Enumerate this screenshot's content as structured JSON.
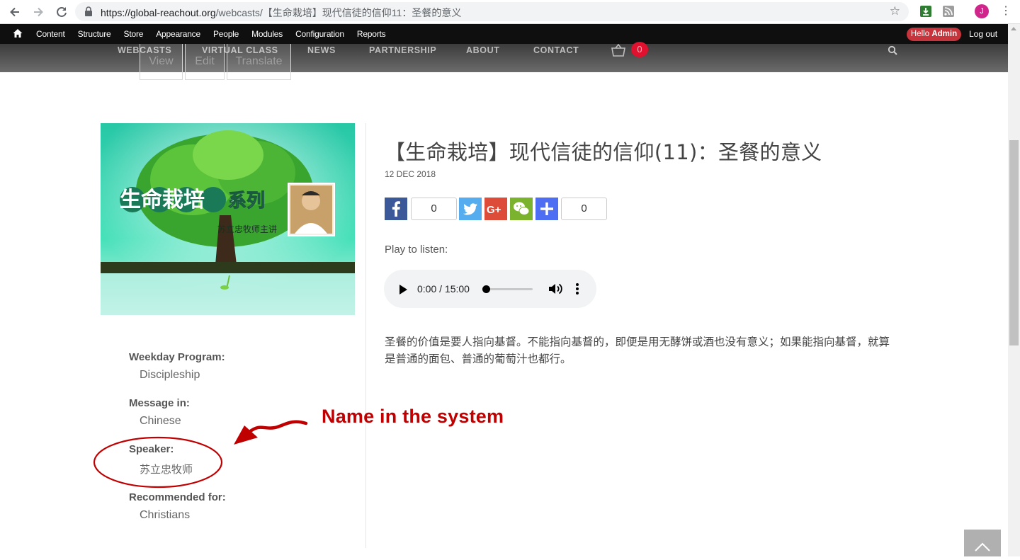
{
  "browser": {
    "url_host": "https://global-reachout.org",
    "url_path": "/webcasts/【生命栽培】现代信徒的信仰11：圣餐的意义",
    "profile_initial": "J",
    "icons": [
      "back-arrow-icon",
      "forward-arrow-icon",
      "reload-icon",
      "lock-icon",
      "star-icon",
      "download-extension-icon",
      "rss-extension-icon",
      "profile-avatar",
      "more-vert-icon"
    ]
  },
  "admin_toolbar": {
    "menu": [
      "Content",
      "Structure",
      "Store",
      "Appearance",
      "People",
      "Modules",
      "Configuration",
      "Reports"
    ],
    "hello_prefix": "Hello",
    "hello_user": "Admin",
    "logout": "Log out"
  },
  "site_nav": {
    "items": [
      "WEBCASTS",
      "VIRTUAL CLASS",
      "NEWS",
      "PARTNERSHIP",
      "ABOUT",
      "CONTACT"
    ],
    "cart_count": "0"
  },
  "tabs": [
    "View",
    "Edit",
    "Translate"
  ],
  "webcast": {
    "hero_title": "生命栽培",
    "hero_series": "系列",
    "hero_byline": "苏立忠牧师主讲",
    "title": "【生命栽培】现代信徒的信仰(11)：圣餐的意义",
    "date": "12 DEC 2018",
    "share_count_1": "0",
    "share_count_2": "0",
    "share_icons": [
      "facebook-icon",
      "twitter-icon",
      "google-plus-icon",
      "wechat-icon",
      "addthis-plus-icon"
    ],
    "play_label": "Play to listen:",
    "audio_time": "0:00 / 15:00",
    "description": "圣餐的价值是要人指向基督。不能指向基督的，即便是用无酵饼或酒也没有意义；如果能指向基督，就算是普通的面包、普通的葡萄汁也都行。"
  },
  "meta": [
    {
      "label": "Weekday Program:",
      "value": "Discipleship"
    },
    {
      "label": "Message in:",
      "value": "Chinese"
    },
    {
      "label": "Speaker:",
      "value": "苏立忠牧师"
    },
    {
      "label": "Recommended for:",
      "value": "Christians"
    }
  ],
  "annotation": {
    "text": "Name in the system",
    "color": "#c00000"
  },
  "colors": {
    "admin_bar": "#0f0f0f",
    "hello_badge": "#c8343b",
    "cart_badge": "#e0102f",
    "facebook": "#3b5998",
    "twitter": "#55acee",
    "google_plus": "#dd4b39",
    "wechat": "#7bb32e",
    "addthis": "#4d6ef3"
  }
}
